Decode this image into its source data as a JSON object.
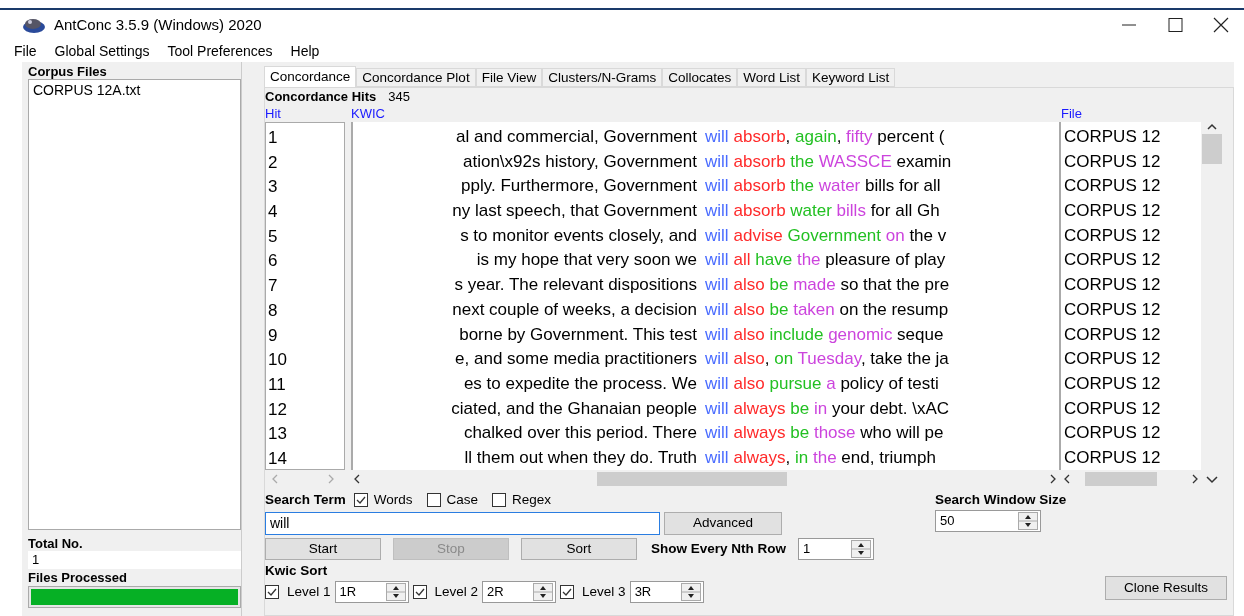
{
  "window": {
    "title": "AntConc 3.5.9 (Windows) 2020"
  },
  "menu": [
    "File",
    "Global Settings",
    "Tool Preferences",
    "Help"
  ],
  "corpus_files": {
    "label": "Corpus Files",
    "files": [
      {
        "name": "CORPUS 12A.txt",
        "selected": false
      }
    ]
  },
  "total_no": {
    "label": "Total No.",
    "value": "1"
  },
  "files_processed": {
    "label": "Files Processed",
    "level": 1
  },
  "tabs": [
    {
      "label": "Concordance",
      "selected": true
    },
    {
      "label": "Concordance Plot",
      "selected": false
    },
    {
      "label": "File View",
      "selected": false
    },
    {
      "label": "Clusters/N-Grams",
      "selected": false
    },
    {
      "label": "Collocates",
      "selected": false
    },
    {
      "label": "Word List",
      "selected": false
    },
    {
      "label": "Keyword List",
      "selected": false
    }
  ],
  "hits": {
    "label": "Concordance Hits",
    "value": "345"
  },
  "columns": {
    "hit": "Hit",
    "kwic": "KWIC",
    "file": "File"
  },
  "rows": [
    {
      "hit": "1",
      "left": "al and commercial, Government",
      "node": "will",
      "right": [
        {
          "text": "absorb",
          "kind": "level1"
        },
        {
          "text": ",",
          "kind": "plain"
        },
        {
          "text": " again",
          "kind": "level2"
        },
        {
          "text": ",",
          "kind": "plain"
        },
        {
          "text": " fifty",
          "kind": "level3"
        },
        {
          "text": " percent (",
          "kind": "plain"
        }
      ],
      "file": "CORPUS 12"
    },
    {
      "hit": "2",
      "left": "ation\\x92s history, Government",
      "node": "will",
      "right": [
        {
          "text": "absorb",
          "kind": "level1"
        },
        {
          "text": " the",
          "kind": "level2"
        },
        {
          "text": " WASSCE",
          "kind": "level3"
        },
        {
          "text": " examin",
          "kind": "plain"
        }
      ],
      "file": "CORPUS 12"
    },
    {
      "hit": "3",
      "left": "pply. Furthermore, Government",
      "node": "will",
      "right": [
        {
          "text": "absorb",
          "kind": "level1"
        },
        {
          "text": " the",
          "kind": "level2"
        },
        {
          "text": " water",
          "kind": "level3"
        },
        {
          "text": " bills for all",
          "kind": "plain"
        }
      ],
      "file": "CORPUS 12"
    },
    {
      "hit": "4",
      "left": "ny last speech, that Government",
      "node": "will",
      "right": [
        {
          "text": "absorb",
          "kind": "level1"
        },
        {
          "text": " water",
          "kind": "level2"
        },
        {
          "text": " bills",
          "kind": "level3"
        },
        {
          "text": " for all Gh",
          "kind": "plain"
        }
      ],
      "file": "CORPUS 12"
    },
    {
      "hit": "5",
      "left": "s to monitor events closely, and",
      "node": "will",
      "right": [
        {
          "text": "advise",
          "kind": "level1"
        },
        {
          "text": " Government",
          "kind": "level2"
        },
        {
          "text": " on",
          "kind": "level3"
        },
        {
          "text": " the v",
          "kind": "plain"
        }
      ],
      "file": "CORPUS 12"
    },
    {
      "hit": "6",
      "left": "is my hope that very soon we",
      "node": "will",
      "right": [
        {
          "text": "all",
          "kind": "level1"
        },
        {
          "text": " have",
          "kind": "level2"
        },
        {
          "text": " the",
          "kind": "level3"
        },
        {
          "text": " pleasure of play",
          "kind": "plain"
        }
      ],
      "file": "CORPUS 12"
    },
    {
      "hit": "7",
      "left": "s year. The relevant dispositions",
      "node": "will",
      "right": [
        {
          "text": "also",
          "kind": "level1"
        },
        {
          "text": " be",
          "kind": "level2"
        },
        {
          "text": " made",
          "kind": "level3"
        },
        {
          "text": " so that the pre",
          "kind": "plain"
        }
      ],
      "file": "CORPUS 12"
    },
    {
      "hit": "8",
      "left": "next couple of weeks, a decision",
      "node": "will",
      "right": [
        {
          "text": "also",
          "kind": "level1"
        },
        {
          "text": " be",
          "kind": "level2"
        },
        {
          "text": " taken",
          "kind": "level3"
        },
        {
          "text": " on the resump",
          "kind": "plain"
        }
      ],
      "file": "CORPUS 12"
    },
    {
      "hit": "9",
      "left": "borne by Government. This test",
      "node": "will",
      "right": [
        {
          "text": "also",
          "kind": "level1"
        },
        {
          "text": " include",
          "kind": "level2"
        },
        {
          "text": " genomic",
          "kind": "level3"
        },
        {
          "text": " seque",
          "kind": "plain"
        }
      ],
      "file": "CORPUS 12"
    },
    {
      "hit": "10",
      "left": "e, and some media practitioners",
      "node": "will",
      "right": [
        {
          "text": "also",
          "kind": "level1"
        },
        {
          "text": ",",
          "kind": "plain"
        },
        {
          "text": " on",
          "kind": "level2"
        },
        {
          "text": " Tuesday",
          "kind": "level3"
        },
        {
          "text": ", take the ja",
          "kind": "plain"
        }
      ],
      "file": "CORPUS 12"
    },
    {
      "hit": "11",
      "left": "es to expedite the process. We",
      "node": "will",
      "right": [
        {
          "text": "also",
          "kind": "level1"
        },
        {
          "text": " pursue",
          "kind": "level2"
        },
        {
          "text": " a",
          "kind": "level3"
        },
        {
          "text": " policy of testi",
          "kind": "plain"
        }
      ],
      "file": "CORPUS 12"
    },
    {
      "hit": "12",
      "left": "ciated, and the Ghanaian people",
      "node": "will",
      "right": [
        {
          "text": "always",
          "kind": "level1"
        },
        {
          "text": " be",
          "kind": "level2"
        },
        {
          "text": " in",
          "kind": "level3"
        },
        {
          "text": " your debt. \\xAC",
          "kind": "plain"
        }
      ],
      "file": "CORPUS 12"
    },
    {
      "hit": "13",
      "left": "chalked over this period. There",
      "node": "will",
      "right": [
        {
          "text": "always",
          "kind": "level1"
        },
        {
          "text": " be",
          "kind": "level2"
        },
        {
          "text": " those",
          "kind": "level3"
        },
        {
          "text": " who will pe",
          "kind": "plain"
        }
      ],
      "file": "CORPUS 12"
    },
    {
      "hit": "14",
      "left": "ll them out when they do. Truth",
      "node": "will",
      "right": [
        {
          "text": "always",
          "kind": "level1"
        },
        {
          "text": ",",
          "kind": "plain"
        },
        {
          "text": " in",
          "kind": "level2"
        },
        {
          "text": " the",
          "kind": "level3"
        },
        {
          "text": " end, triumph",
          "kind": "plain"
        }
      ],
      "file": "CORPUS 12"
    }
  ],
  "search": {
    "label": "Search Term",
    "options": [
      {
        "label": "Words",
        "checked": true
      },
      {
        "label": "Case",
        "checked": false
      },
      {
        "label": "Regex",
        "checked": false
      }
    ],
    "value": "will",
    "advanced": "Advanced"
  },
  "buttons": [
    {
      "label": "Start",
      "disabled": false
    },
    {
      "label": "Stop",
      "disabled": true
    },
    {
      "label": "Sort",
      "disabled": false
    }
  ],
  "nth_row": {
    "label": "Show Every Nth Row",
    "value": "1"
  },
  "window_size": {
    "label": "Search Window Size",
    "value": "50"
  },
  "kwic_sort": {
    "label": "Kwic Sort",
    "levels": [
      {
        "label": "Level 1",
        "checked": true,
        "value": "1R"
      },
      {
        "label": "Level 2",
        "checked": true,
        "value": "2R"
      },
      {
        "label": "Level 3",
        "checked": true,
        "value": "3R"
      }
    ]
  },
  "clone": "Clone Results"
}
